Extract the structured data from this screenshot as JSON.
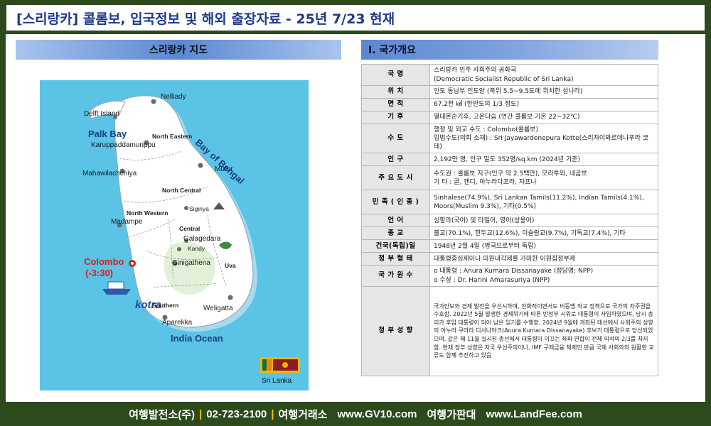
{
  "header": {
    "title": "[스리랑카] 콜롬보, 입국정보 및 해외 출장자료 - 25년 7/23 현재"
  },
  "map_section": {
    "title": "스리랑카 지도",
    "labels": {
      "nelliady": "Nelliady",
      "delft_island": "Delft Island",
      "palk_bay": "Palk Bay",
      "north_eastern": "North Eastern",
      "karuppaddamurippu": "Karuppaddamurippu",
      "bay_of_bengal": "Bay of Bengal",
      "mahawilachchiya": "Mahawilachchiya",
      "mutur": "Mutur",
      "north_central": "North Central",
      "north_western": "North Western",
      "sigiriya": "Sigiriya",
      "madampe": "Madampe",
      "central": "Central",
      "galagedara": "Galagedara",
      "kandy": "Kandy",
      "colombo": "Colombo",
      "colombo_tz": "(-3:30)",
      "ginigathena": "Ginigathena",
      "uva": "Uva",
      "kotra": "kotra",
      "southern": "Southern",
      "weligatta": "Weligatta",
      "aparekka": "Aparekka",
      "india_ocean": "India Ocean",
      "sri_lanka": "Sri Lanka"
    }
  },
  "info_section": {
    "title": "Ⅰ. 국가개요",
    "rows": [
      {
        "key": "국        명",
        "value": "스리랑카 민주 사회주의 공화국\n(Democratic Socialist Republic of Sri Lanka)"
      },
      {
        "key": "위        치",
        "value": "인도 동남부 인도양 (북위 5.5~9.5도에 위치한 섬나라)"
      },
      {
        "key": "면        적",
        "value": "67.2천 ㎢ (한반도의 1/3 정도)"
      },
      {
        "key": "기        후",
        "value": "열대몬순기후, 고온다습 (연간 콜롬보 기온 22~32℃)"
      },
      {
        "key": "수        도",
        "value": "행정 및 외교 수도 : Colombo(콜롬보)\n입법수도(의회 소재) : Sri Jayawardenepura Kotte(스리자야와르데나푸라 코테)"
      },
      {
        "key": "인        구",
        "value": "2,192만 명, 인구 밀도 352명/sq.km (2024년 기준)"
      },
      {
        "key": "주 요  도 시",
        "value": "수도권 : 콜롬보 지구(인구 약 2.5백만), 모라투와, 네곰보\n기 타 : 골, 캔디, 아누라다프라, 자프나"
      },
      {
        "key": "민 족 ( 인 종 )",
        "value": "Sinhalese(74.9%), Sri Lankan Tamils(11.2%), Indian Tamils(4.1%),\nMoors(Muslim 9.3%), 기타(0.5%)"
      },
      {
        "key": "언        어",
        "value": "싱할라(국어) 및 타밀어, 영어(상용어)"
      },
      {
        "key": "종        교",
        "value": "불교(70.1%), 힌두교(12.6%), 이슬람교(9.7%), 기독교(7.4%), 기타"
      },
      {
        "key": "건국(독립)일",
        "value": "1948년 2월 4일 (영국으로부터 독립)"
      },
      {
        "key": "정 부  형 태",
        "value": "대통령중심제이나 의원내각제를 가미한 이원집정부제"
      },
      {
        "key": "국 가  원 수",
        "value": "o 대통령 : Anura Kumara Dissanayake (정당명: NPP)\no 수상 : Dr. Harini Amarasuriya (NPP)"
      },
      {
        "key": "정 부  성 향",
        "value": "국가안보와 경제 발전을 우선시하며, 친화적이면서도 비동맹 외교 정책으로 국가의 자주권을 수호함. 2022년 5월 발생한 경제위기에 따른 반정부 시위로 대통령이 사임하였으며, 당시 총리가 후임 대통령이 되어 남은 임기를 수행함. 2024년 9월에 개최된 대선에서 사회주의 성향의 아누라 쿠마라 디사나야크(Anura Kumara Dissanayake) 후보가 대통령으로 당선되었으며, 같은 해 11월 실시된 총선에서 대통령이 이끄는 좌파 연합이 전체 의석의 2/3를 차지함. 현재 정부 성향은 자국 우선주의이나, IMF 구제금융 체제인 만큼 국제 사회와의 원활한 교류도 함께 추진하고 있음"
      }
    ]
  },
  "footer": {
    "company": "여행발전소(주)",
    "phone": "02-723-2100",
    "label1": "여행거래소",
    "site1": "www.GV10.com",
    "label2": "여행가판대",
    "site2": "www.LandFee.com"
  },
  "colors": {
    "frame": "#2c4a1c",
    "title_text": "#1a3a8c",
    "sea": "#5bc3e6",
    "land": "#ffffff",
    "colombo_marker": "#d81e1e",
    "footer_separator": "#f2c200"
  }
}
